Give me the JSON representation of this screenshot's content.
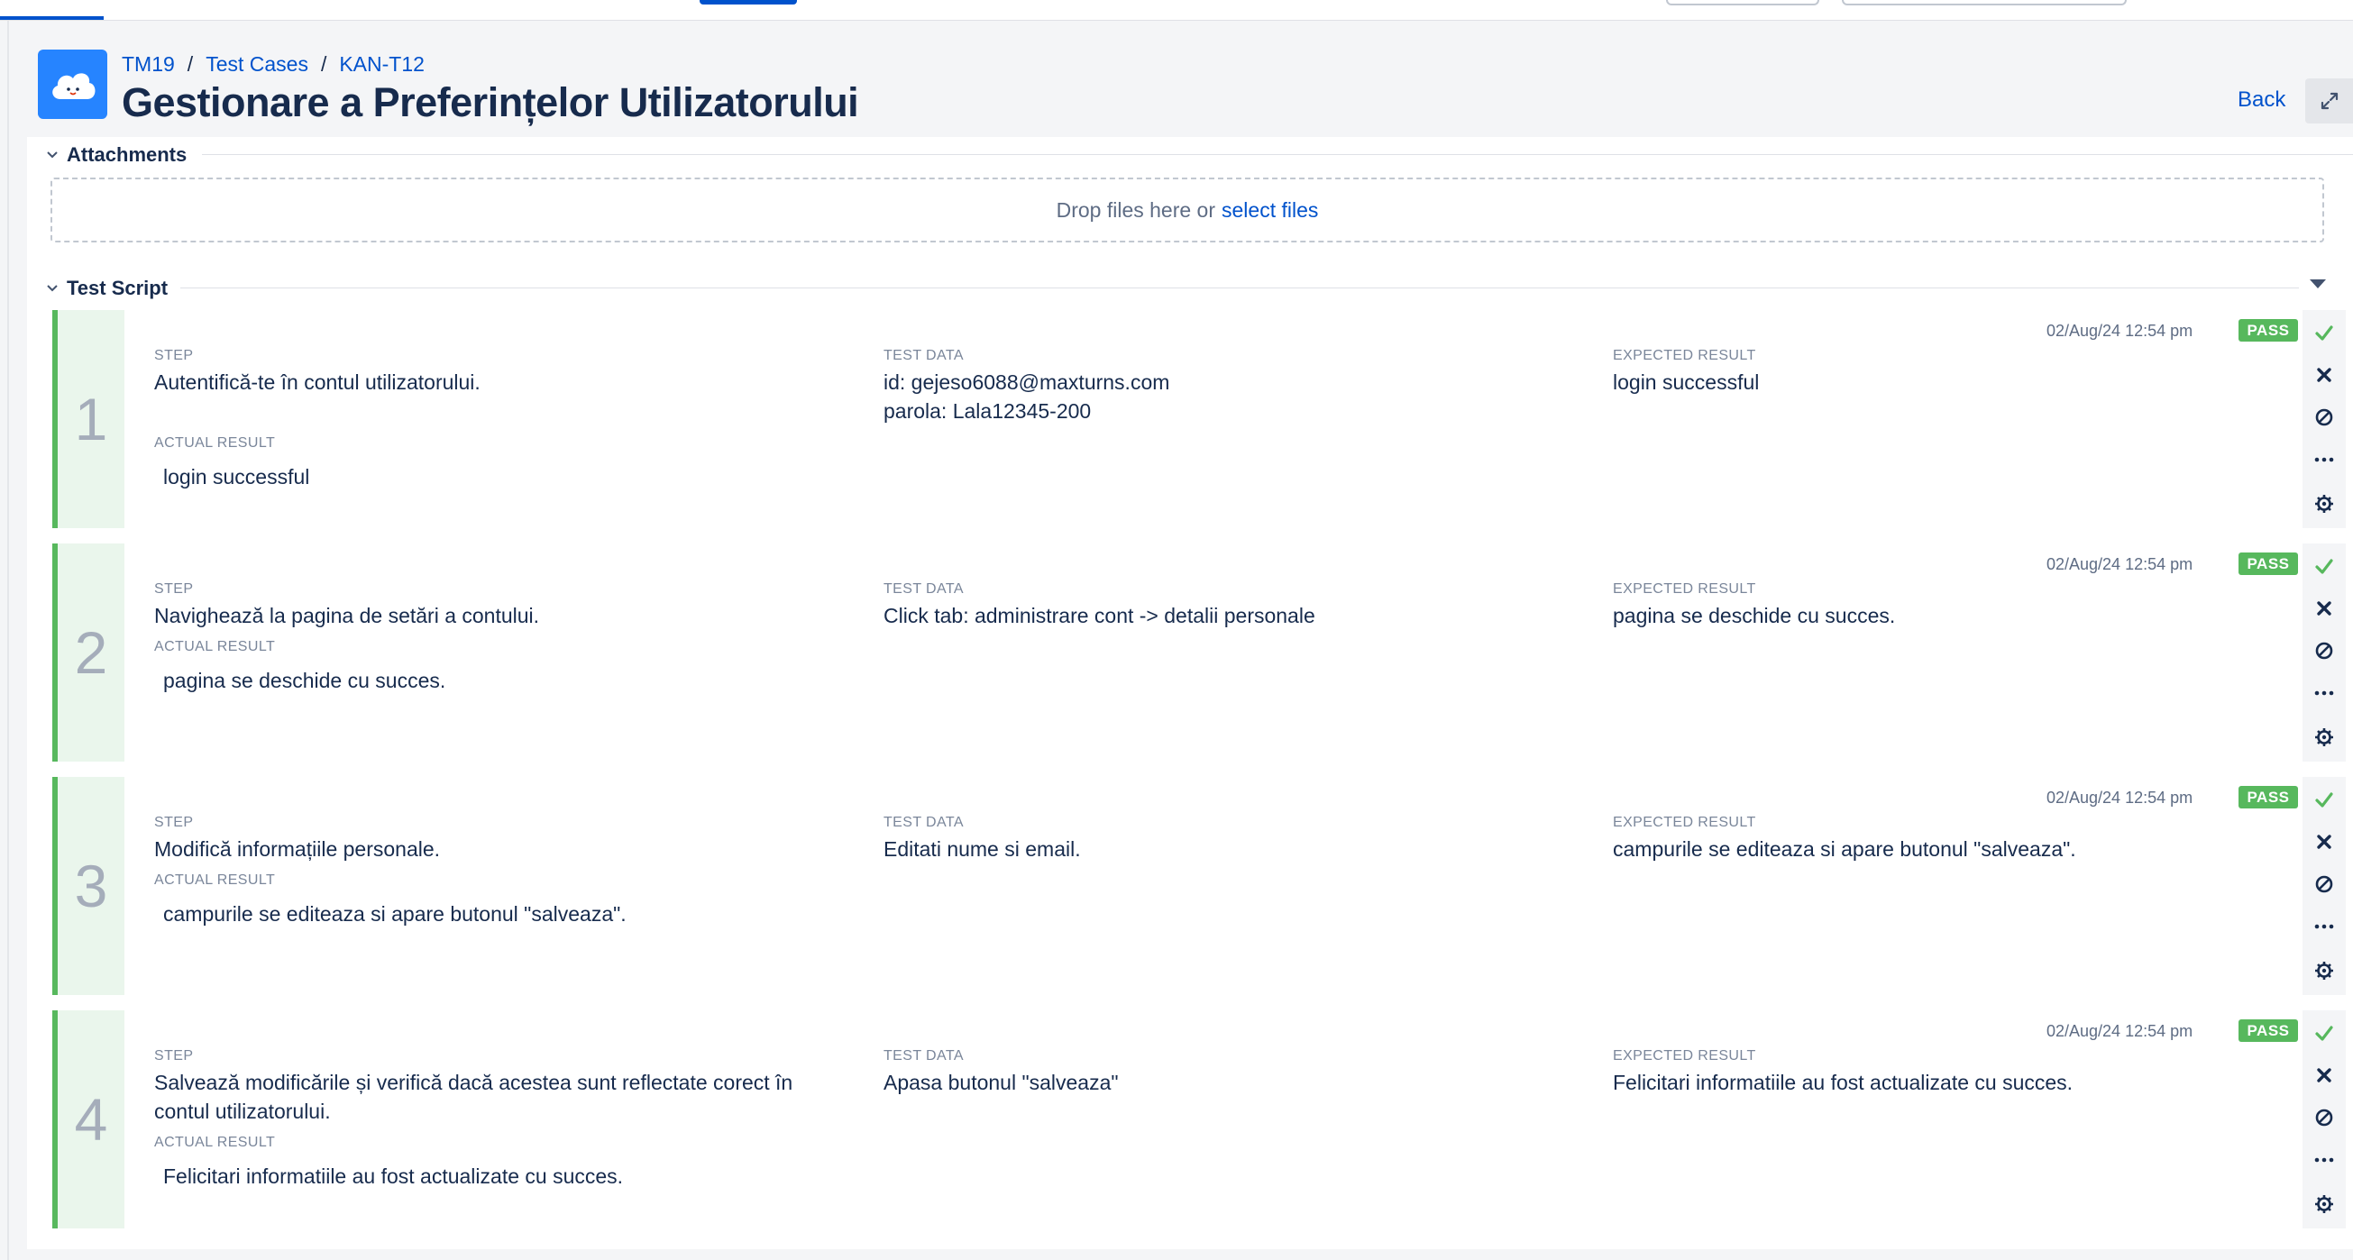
{
  "header": {
    "breadcrumb": [
      {
        "label": "TM19"
      },
      {
        "label": "Test Cases"
      },
      {
        "label": "KAN-T12"
      }
    ],
    "separator": "/",
    "title": "Gestionare a Preferințelor Utilizatorului",
    "back_label": "Back"
  },
  "attachments": {
    "title": "Attachments",
    "drop_text": "Drop files here or",
    "select_link": "select files"
  },
  "test_script": {
    "title": "Test Script",
    "labels": {
      "step": "STEP",
      "test_data": "TEST DATA",
      "expected": "EXPECTED RESULT",
      "actual": "ACTUAL RESULT"
    },
    "steps": [
      {
        "number": "1",
        "step": "Autentifică-te în contul utilizatorului.",
        "test_data": "id: gejeso6088@maxturns.com\nparola: Lala12345-200",
        "expected": "login successful",
        "actual": "login successful",
        "timestamp": "02/Aug/24 12:54 pm",
        "status": "PASS"
      },
      {
        "number": "2",
        "step": "Navighează la pagina de setări a contului.",
        "test_data": "Click tab: administrare cont -> detalii personale",
        "expected": "pagina se deschide cu succes.",
        "actual": "pagina se deschide cu succes.",
        "timestamp": "02/Aug/24 12:54 pm",
        "status": "PASS"
      },
      {
        "number": "3",
        "step": "Modifică informațiile personale.",
        "test_data": "Editati nume si email.",
        "expected": "campurile se editeaza si apare butonul \"salveaza\".",
        "actual": "campurile se editeaza si apare butonul \"salveaza\".",
        "timestamp": "02/Aug/24 12:54 pm",
        "status": "PASS"
      },
      {
        "number": "4",
        "step": "Salvează modificările și verifică dacă acestea sunt reflectate corect în\ncontul utilizatorului.",
        "test_data": "Apasa butonul \"salveaza\"",
        "expected": "Felicitari informatiile au fost actualizate cu succes.",
        "actual": "Felicitari informatiile au fost actualizate cu succes.",
        "timestamp": "02/Aug/24 12:54 pm",
        "status": "PASS"
      }
    ],
    "action_icons": [
      "check-icon",
      "cross-icon",
      "blocked-icon",
      "more-icon",
      "settings-icon"
    ]
  },
  "colors": {
    "pass": "#57b85d",
    "link": "#0052cc",
    "logo": "#2684ff",
    "step_number_bg": "#eaf6ec"
  }
}
